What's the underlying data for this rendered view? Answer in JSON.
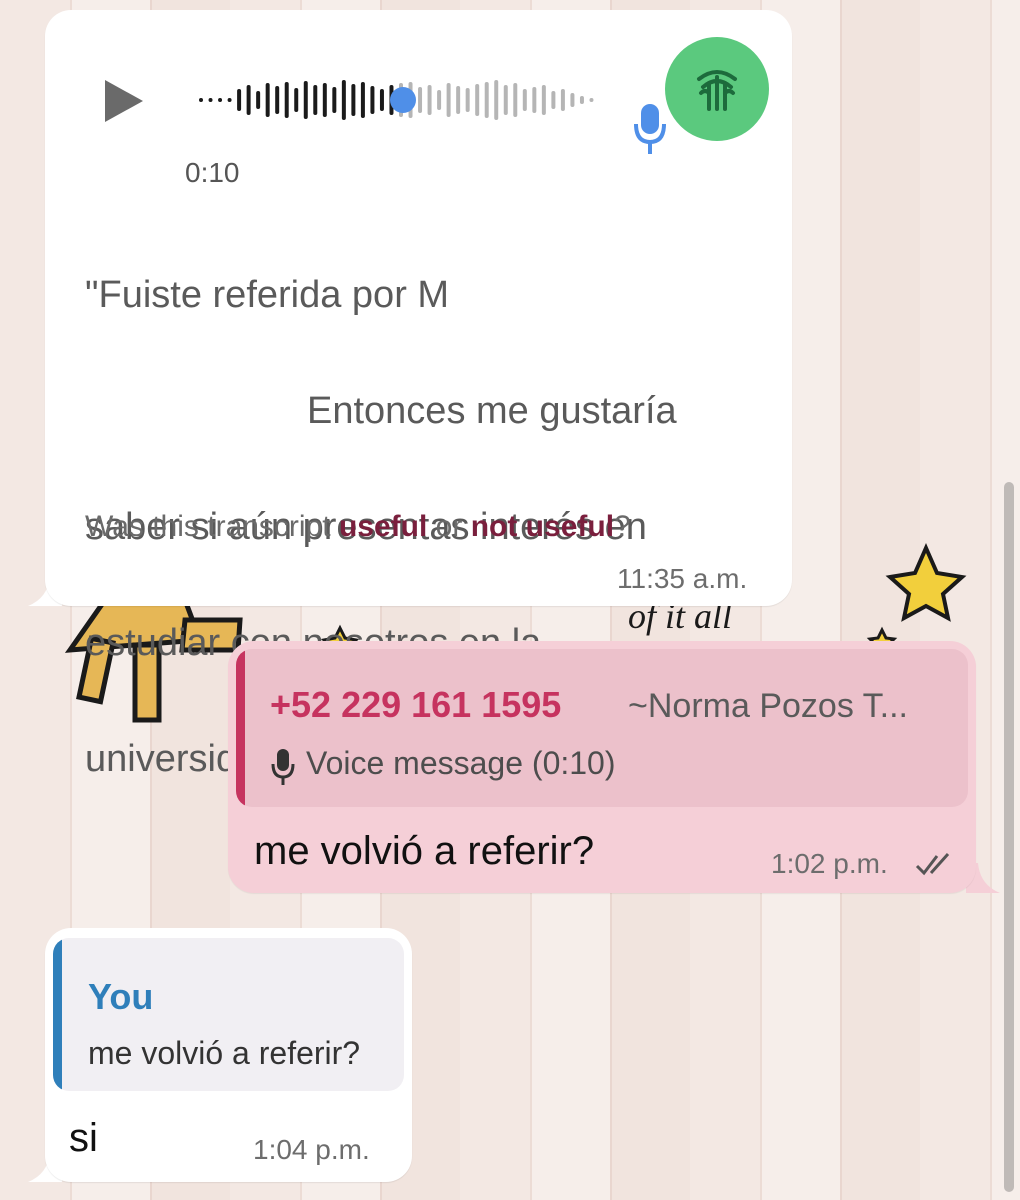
{
  "voice_message": {
    "duration": "0:10",
    "playback_progress": 0.48,
    "transcript_lines": [
      "\"Fuiste referida por M",
      "Entonces me gustaría",
      "saber si aún presentas interés en",
      "estudiar con nosotros en la",
      "universidad ___ _______\""
    ],
    "feedback": {
      "prefix": "Was this transcript",
      "useful_label": "useful",
      "connector": "or",
      "not_useful_label": "not useful",
      "suffix": "?"
    },
    "time": "11:35 a.m.",
    "avatar_icon": "university-logo-icon",
    "avatar_color": "#5bc97e"
  },
  "outgoing_message": {
    "quoted": {
      "phone": "+52 229 161 1595",
      "name": "~Norma Pozos T...",
      "content": "Voice message (0:10)",
      "accent": "#c6335f"
    },
    "text": "me volvió a referir?",
    "time": "1:02 p.m.",
    "status_icon": "double-check-icon"
  },
  "reply_message": {
    "quoted": {
      "author": "You",
      "text": "me volvió a referir?",
      "accent": "#2f7fba"
    },
    "text": "si",
    "time": "1:04 p.m."
  },
  "wallpaper_text": "of it all",
  "colors": {
    "incoming_bubble": "#ffffff",
    "outgoing_bubble": "#f5cfd7",
    "feedback_link": "#7a1f3d"
  }
}
